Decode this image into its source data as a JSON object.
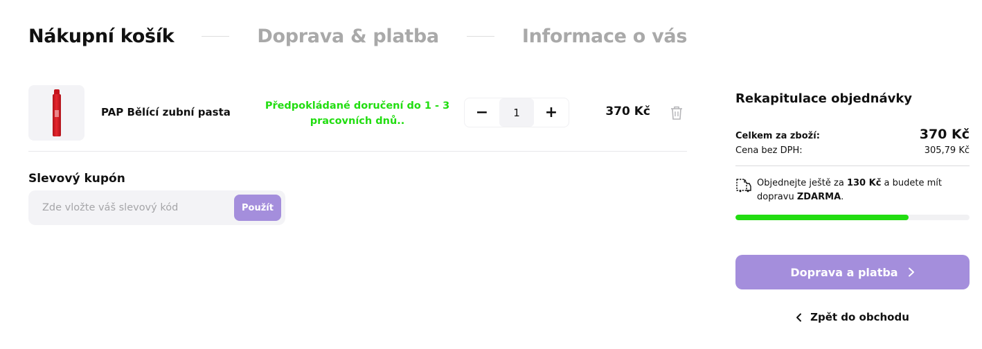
{
  "steps": [
    {
      "label": "Nákupní košík",
      "active": true
    },
    {
      "label": "Doprava & platba",
      "active": false
    },
    {
      "label": "Informace o vás",
      "active": false
    }
  ],
  "cart": {
    "items": [
      {
        "name": "PAP Bělící zubní pasta",
        "delivery": "Předpokládané doručení do 1 - 3 pracovních dnů..",
        "quantity": "1",
        "price": "370 Kč",
        "qty_minus": "−",
        "qty_plus": "+"
      }
    ]
  },
  "coupon": {
    "title": "Slevový kupón",
    "placeholder": "Zde vložte váš slevový kód",
    "apply_label": "Použít"
  },
  "summary": {
    "title": "Rekapitulace objednávky",
    "total_label": "Celkem za zboží:",
    "total_value": "370 Kč",
    "net_label": "Cena bez DPH:",
    "net_value": "305,79 Kč",
    "shipping_prefix": "Objednejte ještě za ",
    "shipping_amount": "130 Kč",
    "shipping_middle": " a budete mít dopravu ",
    "shipping_free": "ZDARMA",
    "shipping_suffix": ".",
    "progress_percent": 74,
    "cta_label": "Doprava a platba",
    "back_label": "Zpět do obchodu"
  },
  "colors": {
    "accent": "#a48edc",
    "delivery_green": "#22dd11",
    "inactive_step": "#a9a9a9"
  },
  "icons": {
    "trash": "trash-icon",
    "shipping": "shipping-doc-icon",
    "chevron_right": "chevron-right-icon",
    "chevron_left": "chevron-left-icon"
  }
}
